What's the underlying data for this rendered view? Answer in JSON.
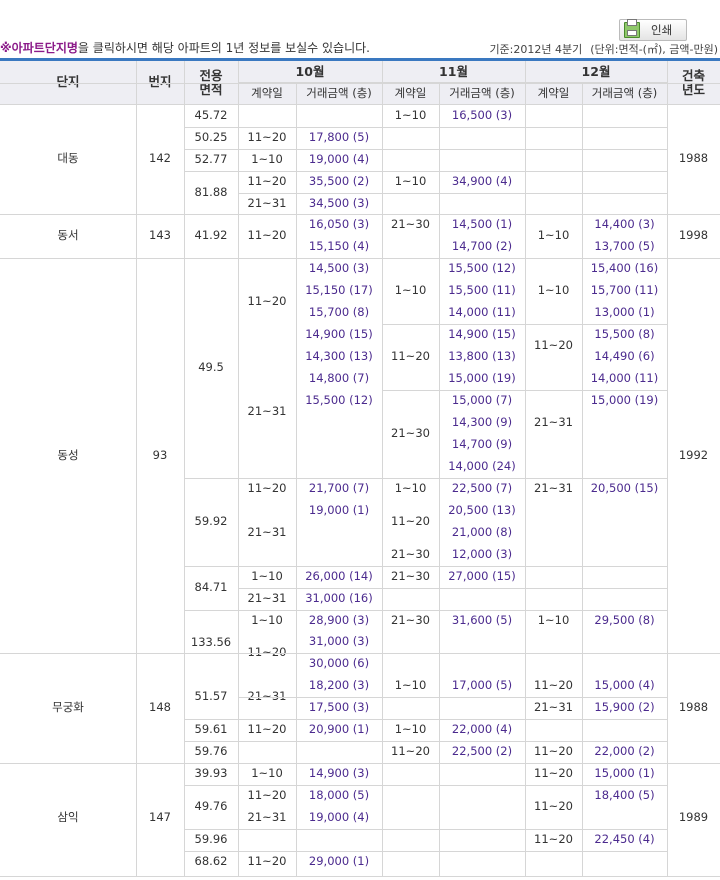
{
  "print_label": "인쇄",
  "notice": {
    "highlight": "※아파트단지명",
    "text": "을 클릭하시면 해당 아파트의 1년 정보를 보실수 있습니다."
  },
  "criteria": {
    "period": "기준:2012년 4분기",
    "unit": "(단위:면적-(㎡), 금액-만원)"
  },
  "header": {
    "complex": "단지",
    "lot": "번지",
    "area": "전용\n면적",
    "months": [
      "10월",
      "11월",
      "12월"
    ],
    "contract_day": "계약일",
    "amount": "거래금액 (층)",
    "year_built": "건축\n년도"
  },
  "complexes": [
    {
      "name": "대동",
      "lot": "142",
      "year": "1988"
    },
    {
      "name": "동서",
      "lot": "143",
      "year": "1998"
    },
    {
      "name": "동성",
      "lot": "93",
      "year": "1992"
    },
    {
      "name": "무궁화",
      "lot": "148",
      "year": "1988"
    },
    {
      "name": "삼익",
      "lot": "147",
      "year": "1989"
    }
  ],
  "areas": [
    "45.72",
    "50.25",
    "52.77",
    "81.88",
    "41.92",
    "49.5",
    "59.92",
    "84.71",
    "133.56",
    "51.57",
    "59.61",
    "59.76",
    "39.93",
    "49.76",
    "59.96",
    "68.62"
  ],
  "oct": {
    "days": [
      "11~20",
      "1~10",
      "11~20",
      "21~31",
      "11~20",
      "11~20",
      "21~31",
      "11~20",
      "21~31",
      "1~10",
      "21~31",
      "1~10",
      "11~20",
      "21~31",
      "11~20",
      "1~10",
      "11~20",
      "21~31",
      "11~20"
    ],
    "prices": [
      "17,800 (5)",
      "19,000 (4)",
      "35,500 (2)",
      "34,500 (3)",
      "16,050 (3)",
      "15,150 (4)",
      "14,500 (3)",
      "15,150 (17)",
      "15,700 (8)",
      "14,900 (15)",
      "14,300 (13)",
      "14,800 (7)",
      "15,500 (12)",
      "21,700 (7)",
      "19,000 (1)",
      "26,000 (14)",
      "31,000 (16)",
      "28,900 (3)",
      "31,000 (3)",
      "30,000 (6)",
      "18,200 (3)",
      "17,500 (3)",
      "20,900 (1)",
      "14,900 (3)",
      "18,000 (5)",
      "19,000 (4)",
      "29,000 (1)"
    ]
  },
  "nov": {
    "days": [
      "1~10",
      "1~10",
      "21~30",
      "1~10",
      "11~20",
      "21~30",
      "1~10",
      "11~20",
      "21~30",
      "21~30",
      "21~30",
      "1~10",
      "1~10",
      "11~20"
    ],
    "prices": [
      "16,500 (3)",
      "34,900 (4)",
      "14,500 (1)",
      "14,700 (2)",
      "15,500 (12)",
      "15,500 (11)",
      "14,000 (11)",
      "14,900 (15)",
      "13,800 (13)",
      "15,000 (19)",
      "15,000 (7)",
      "14,300 (9)",
      "14,700 (9)",
      "14,000 (24)",
      "22,500 (7)",
      "20,500 (13)",
      "21,000 (8)",
      "12,000 (3)",
      "27,000 (15)",
      "31,600 (5)",
      "17,000 (5)",
      "22,000 (4)",
      "22,500 (2)"
    ]
  },
  "dec": {
    "days": [
      "1~10",
      "1~10",
      "11~20",
      "21~31",
      "21~31",
      "1~10",
      "11~20",
      "21~31",
      "11~20",
      "11~20",
      "11~20",
      "11~20"
    ],
    "prices": [
      "14,400 (3)",
      "13,700 (5)",
      "15,400 (16)",
      "15,700 (11)",
      "13,000 (1)",
      "15,500 (8)",
      "14,490 (6)",
      "14,000 (11)",
      "15,000 (19)",
      "20,500 (15)",
      "29,500 (8)",
      "15,000 (4)",
      "15,900 (2)",
      "22,000 (2)",
      "15,000 (1)",
      "18,400 (5)",
      "22,450 (4)"
    ]
  }
}
